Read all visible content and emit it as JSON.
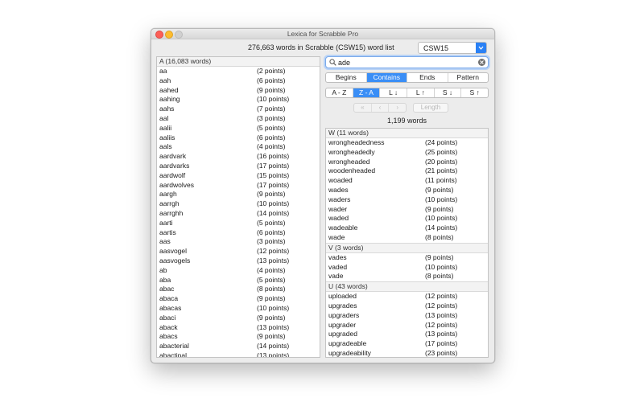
{
  "window": {
    "title": "Lexica for Scrabble Pro"
  },
  "header": {
    "wordlist_text": "276,663 words in Scrabble (CSW15) word list",
    "dictionary": "CSW15"
  },
  "left_list": {
    "section": "A (16,083 words)",
    "rows": [
      {
        "word": "aa",
        "points": "(2 points)"
      },
      {
        "word": "aah",
        "points": "(6 points)"
      },
      {
        "word": "aahed",
        "points": "(9 points)"
      },
      {
        "word": "aahing",
        "points": "(10 points)"
      },
      {
        "word": "aahs",
        "points": "(7 points)"
      },
      {
        "word": "aal",
        "points": "(3 points)"
      },
      {
        "word": "aalii",
        "points": "(5 points)"
      },
      {
        "word": "aaliis",
        "points": "(6 points)"
      },
      {
        "word": "aals",
        "points": "(4 points)"
      },
      {
        "word": "aardvark",
        "points": "(16 points)"
      },
      {
        "word": "aardvarks",
        "points": "(17 points)"
      },
      {
        "word": "aardwolf",
        "points": "(15 points)"
      },
      {
        "word": "aardwolves",
        "points": "(17 points)"
      },
      {
        "word": "aargh",
        "points": "(9 points)"
      },
      {
        "word": "aarrgh",
        "points": "(10 points)"
      },
      {
        "word": "aarrghh",
        "points": "(14 points)"
      },
      {
        "word": "aarti",
        "points": "(5 points)"
      },
      {
        "word": "aartis",
        "points": "(6 points)"
      },
      {
        "word": "aas",
        "points": "(3 points)"
      },
      {
        "word": "aasvogel",
        "points": "(12 points)"
      },
      {
        "word": "aasvogels",
        "points": "(13 points)"
      },
      {
        "word": "ab",
        "points": "(4 points)"
      },
      {
        "word": "aba",
        "points": "(5 points)"
      },
      {
        "word": "abac",
        "points": "(8 points)"
      },
      {
        "word": "abaca",
        "points": "(9 points)"
      },
      {
        "word": "abacas",
        "points": "(10 points)"
      },
      {
        "word": "abaci",
        "points": "(9 points)"
      },
      {
        "word": "aback",
        "points": "(13 points)"
      },
      {
        "word": "abacs",
        "points": "(9 points)"
      },
      {
        "word": "abacterial",
        "points": "(14 points)"
      },
      {
        "word": "abactinal",
        "points": "(13 points)"
      }
    ]
  },
  "search": {
    "query": "ade"
  },
  "match_modes": [
    "Begins",
    "Contains",
    "Ends",
    "Pattern"
  ],
  "match_active": "Contains",
  "sort_modes": [
    "A - Z",
    "Z - A",
    "L ↓",
    "L ↑",
    "S ↓",
    "S ↑"
  ],
  "sort_active": "Z - A",
  "nav": {
    "first": "«",
    "prev": "‹",
    "next": "›",
    "length_label": "Length"
  },
  "result_count": "1,199 words",
  "results": [
    {
      "header": "W (11 words)",
      "rows": [
        {
          "word": "wrongheadedness",
          "points": "(24 points)"
        },
        {
          "word": "wrongheadedly",
          "points": "(25 points)"
        },
        {
          "word": "wrongheaded",
          "points": "(20 points)"
        },
        {
          "word": "woodenheaded",
          "points": "(21 points)"
        },
        {
          "word": "woaded",
          "points": "(11 points)"
        },
        {
          "word": "wades",
          "points": "(9 points)"
        },
        {
          "word": "waders",
          "points": "(10 points)"
        },
        {
          "word": "wader",
          "points": "(9 points)"
        },
        {
          "word": "waded",
          "points": "(10 points)"
        },
        {
          "word": "wadeable",
          "points": "(14 points)"
        },
        {
          "word": "wade",
          "points": "(8 points)"
        }
      ]
    },
    {
      "header": "V (3 words)",
      "rows": [
        {
          "word": "vades",
          "points": "(9 points)"
        },
        {
          "word": "vaded",
          "points": "(10 points)"
        },
        {
          "word": "vade",
          "points": "(8 points)"
        }
      ]
    },
    {
      "header": "U (43 words)",
      "rows": [
        {
          "word": "uploaded",
          "points": "(12 points)"
        },
        {
          "word": "upgrades",
          "points": "(12 points)"
        },
        {
          "word": "upgraders",
          "points": "(13 points)"
        },
        {
          "word": "upgrader",
          "points": "(12 points)"
        },
        {
          "word": "upgraded",
          "points": "(13 points)"
        },
        {
          "word": "upgradeable",
          "points": "(17 points)"
        },
        {
          "word": "upgradeability",
          "points": "(23 points)"
        }
      ]
    }
  ],
  "colors": {
    "accent": "#3a8ef6"
  }
}
